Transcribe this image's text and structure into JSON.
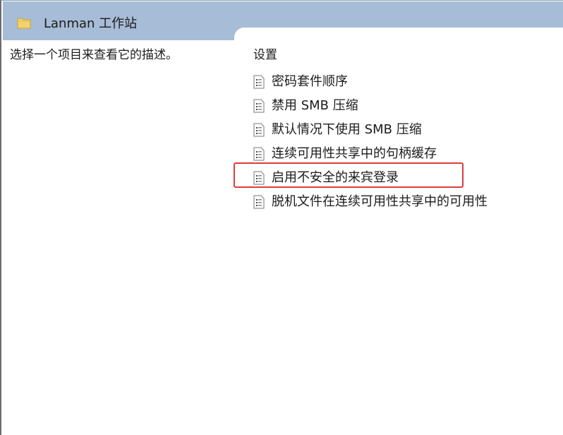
{
  "header": {
    "title": "Lanman 工作站",
    "icon": "folder-icon"
  },
  "left_pane": {
    "description": "选择一个项目来查看它的描述。"
  },
  "settings": {
    "column_header": "设置",
    "items": [
      {
        "label": "密码套件顺序",
        "icon": "policy-setting-icon"
      },
      {
        "label": "禁用 SMB 压缩",
        "icon": "policy-setting-icon"
      },
      {
        "label": "默认情况下使用 SMB 压缩",
        "icon": "policy-setting-icon"
      },
      {
        "label": "连续可用性共享中的句柄缓存",
        "icon": "policy-setting-icon"
      },
      {
        "label": "启用不安全的来宾登录",
        "icon": "policy-setting-icon",
        "highlighted": true
      },
      {
        "label": "脱机文件在连续可用性共享中的可用性",
        "icon": "policy-setting-icon"
      }
    ]
  },
  "colors": {
    "header_band": "#a7bcd6",
    "highlight": "#e03a3a",
    "folder": "#f3d16b"
  }
}
